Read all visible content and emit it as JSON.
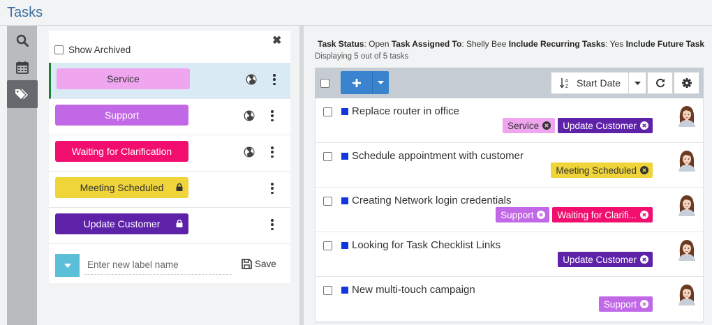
{
  "app": {
    "title": "Tasks"
  },
  "icons": {
    "search": "search-icon",
    "calendar": "calendar-icon",
    "tags": "tags-icon",
    "globe": "globe-icon",
    "lock": "lock-icon",
    "kebab": "kebab-menu-icon",
    "filter": "filter-icon",
    "plus": "plus-icon",
    "sort": "sort-alpha-icon",
    "refresh": "refresh-icon",
    "gear": "gear-icon",
    "save": "floppy-disk-icon",
    "close": "close-icon"
  },
  "label_panel": {
    "show_archived_label": "Show Archived",
    "close_glyph": "✖",
    "labels": [
      {
        "name": "Service",
        "bg": "#f0a6ee",
        "fg": "#333333",
        "public": true,
        "locked": false,
        "selected": true
      },
      {
        "name": "Support",
        "bg": "#c168e6",
        "fg": "#ffffff",
        "public": true,
        "locked": false,
        "selected": false
      },
      {
        "name": "Waiting for Clarification",
        "bg": "#f20e6e",
        "fg": "#ffffff",
        "public": true,
        "locked": false,
        "selected": false
      },
      {
        "name": "Meeting Scheduled",
        "bg": "#efd43a",
        "fg": "#333333",
        "public": false,
        "locked": true,
        "selected": false
      },
      {
        "name": "Update Customer",
        "bg": "#5e22a9",
        "fg": "#ffffff",
        "public": false,
        "locked": true,
        "selected": false
      }
    ],
    "new_label_placeholder": "Enter new label name",
    "save_label": "Save"
  },
  "filter": {
    "parts": [
      {
        "key": "Task Status",
        "value": "Open"
      },
      {
        "key": "Task Assigned To",
        "value": "Shelly Bee"
      },
      {
        "key": "Include Recurring Tasks",
        "value": "Yes"
      },
      {
        "key": "Include Future Tasks",
        "value": "..."
      }
    ],
    "displaying_text": "Displaying 5 out of 5 tasks"
  },
  "toolbar": {
    "sort_label": "Start Date"
  },
  "tasks": [
    {
      "title": "Replace router in office",
      "tags": [
        {
          "text": "Service",
          "bg": "#f0a6ee",
          "fg": "#333333"
        },
        {
          "text": "Update Customer",
          "bg": "#5e22a9",
          "fg": "#ffffff"
        }
      ]
    },
    {
      "title": "Schedule appointment with customer",
      "tags": [
        {
          "text": "Meeting Scheduled",
          "bg": "#efd43a",
          "fg": "#333333"
        }
      ]
    },
    {
      "title": "Creating Network login credentials",
      "tags": [
        {
          "text": "Support",
          "bg": "#c168e6",
          "fg": "#ffffff"
        },
        {
          "text": "Waiting for Clarifi...",
          "bg": "#f20e6e",
          "fg": "#ffffff"
        }
      ]
    },
    {
      "title": "Looking for Task Checklist Links",
      "tags": [
        {
          "text": "Update Customer",
          "bg": "#5e22a9",
          "fg": "#ffffff"
        }
      ]
    },
    {
      "title": "New multi-touch campaign",
      "tags": [
        {
          "text": "Support",
          "bg": "#c168e6",
          "fg": "#ffffff"
        }
      ]
    }
  ]
}
